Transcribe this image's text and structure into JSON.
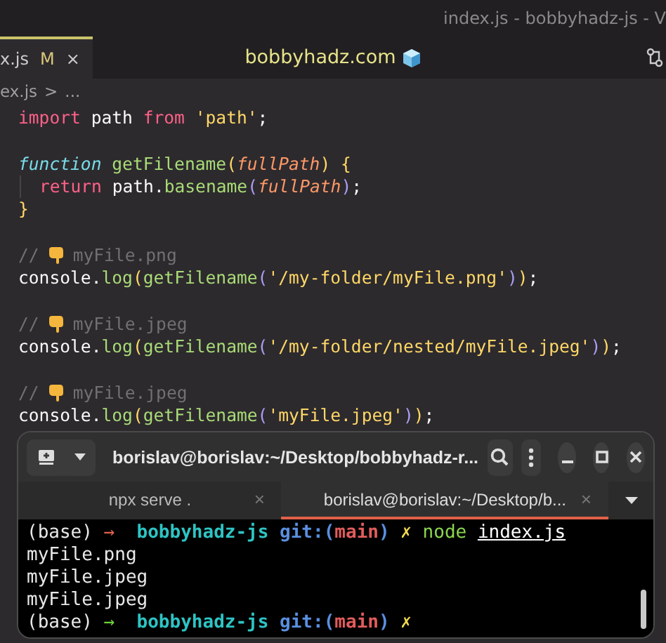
{
  "window": {
    "title": "index.js - bobbyhadz-js - V"
  },
  "editor_tabs": [
    {
      "label": "x.js",
      "badge": "M",
      "close": "×",
      "selected": true
    }
  ],
  "site_label": "bobbyhadz.com",
  "breadcrumb": {
    "file": "ex.js",
    "separator": ">",
    "rest": "..."
  },
  "code_lines": [
    {
      "kind": "code",
      "indented": false,
      "tokens": [
        {
          "kind": "kw",
          "text": "import"
        },
        {
          "kind": "plain",
          "text": " path "
        },
        {
          "kind": "kw",
          "text": "from "
        },
        {
          "kind": "str",
          "text": "'path'"
        },
        {
          "kind": "plain",
          "text": ";"
        }
      ]
    },
    {
      "kind": "blank"
    },
    {
      "kind": "code",
      "indented": false,
      "tokens": [
        {
          "kind": "storage",
          "text": "function "
        },
        {
          "kind": "fn",
          "text": "getFilename"
        },
        {
          "kind": "brace",
          "text": "("
        },
        {
          "kind": "param",
          "text": "fullPath"
        },
        {
          "kind": "brace",
          "text": ") {"
        }
      ]
    },
    {
      "kind": "code",
      "indented": true,
      "tokens": [
        {
          "kind": "kw",
          "text": "return"
        },
        {
          "kind": "plain",
          "text": " path."
        },
        {
          "kind": "fn",
          "text": "basename"
        },
        {
          "kind": "paren",
          "text": "("
        },
        {
          "kind": "param",
          "text": "fullPath"
        },
        {
          "kind": "paren",
          "text": ")"
        },
        {
          "kind": "plain",
          "text": ";"
        }
      ]
    },
    {
      "kind": "code",
      "indented": false,
      "tokens": [
        {
          "kind": "brace",
          "text": "}"
        }
      ]
    },
    {
      "kind": "blank"
    },
    {
      "kind": "code",
      "indented": false,
      "tokens": [
        {
          "kind": "comment",
          "text": "//"
        },
        {
          "kind": "hand"
        },
        {
          "kind": "comment",
          "text": "myFile.png"
        }
      ]
    },
    {
      "kind": "code",
      "indented": false,
      "tokens": [
        {
          "kind": "plain",
          "text": "console."
        },
        {
          "kind": "fn",
          "text": "log"
        },
        {
          "kind": "brace",
          "text": "("
        },
        {
          "kind": "fn",
          "text": "getFilename"
        },
        {
          "kind": "paren",
          "text": "("
        },
        {
          "kind": "str",
          "text": "'/my-folder/myFile.png'"
        },
        {
          "kind": "paren",
          "text": ")"
        },
        {
          "kind": "brace",
          "text": ")"
        },
        {
          "kind": "plain",
          "text": ";"
        }
      ]
    },
    {
      "kind": "blank"
    },
    {
      "kind": "code",
      "indented": false,
      "tokens": [
        {
          "kind": "comment",
          "text": "//"
        },
        {
          "kind": "hand"
        },
        {
          "kind": "comment",
          "text": "myFile.jpeg"
        }
      ]
    },
    {
      "kind": "code",
      "indented": false,
      "tokens": [
        {
          "kind": "plain",
          "text": "console."
        },
        {
          "kind": "fn",
          "text": "log"
        },
        {
          "kind": "brace",
          "text": "("
        },
        {
          "kind": "fn",
          "text": "getFilename"
        },
        {
          "kind": "paren",
          "text": "("
        },
        {
          "kind": "str",
          "text": "'/my-folder/nested/myFile.jpeg'"
        },
        {
          "kind": "paren",
          "text": ")"
        },
        {
          "kind": "brace",
          "text": ")"
        },
        {
          "kind": "plain",
          "text": ";"
        }
      ]
    },
    {
      "kind": "blank"
    },
    {
      "kind": "code",
      "indented": false,
      "tokens": [
        {
          "kind": "comment",
          "text": "//"
        },
        {
          "kind": "hand"
        },
        {
          "kind": "comment",
          "text": "myFile.jpeg"
        }
      ]
    },
    {
      "kind": "code",
      "indented": false,
      "tokens": [
        {
          "kind": "plain",
          "text": "console."
        },
        {
          "kind": "fn",
          "text": "log"
        },
        {
          "kind": "brace",
          "text": "("
        },
        {
          "kind": "fn",
          "text": "getFilename"
        },
        {
          "kind": "paren",
          "text": "("
        },
        {
          "kind": "str",
          "text": "'myFile.jpeg'"
        },
        {
          "kind": "paren",
          "text": ")"
        },
        {
          "kind": "brace",
          "text": ")"
        },
        {
          "kind": "plain",
          "text": ";"
        }
      ]
    }
  ],
  "terminal": {
    "title": "borislav@borislav:~/Desktop/bobbyhadz-r...",
    "tabs": [
      {
        "label": "npx serve .",
        "close": "×",
        "selected": false
      },
      {
        "label": "borislav@borislav:~/Desktop/b...",
        "close": "×",
        "selected": true
      }
    ],
    "lines": [
      [
        {
          "kind": "plain",
          "text": "(base) "
        },
        {
          "kind": "arrow",
          "ok": false,
          "text": "→"
        },
        {
          "kind": "dir",
          "text": "  bobbyhadz-js "
        },
        {
          "kind": "git",
          "text": "git:("
        },
        {
          "kind": "branch",
          "text": "main"
        },
        {
          "kind": "git",
          "text": ")"
        },
        {
          "kind": "dirty",
          "text": " ✗ "
        },
        {
          "kind": "cmd",
          "text": "node "
        },
        {
          "kind": "arg",
          "text": "index.js"
        }
      ],
      [
        {
          "kind": "plain",
          "text": "myFile.png"
        }
      ],
      [
        {
          "kind": "plain",
          "text": "myFile.jpeg"
        }
      ],
      [
        {
          "kind": "plain",
          "text": "myFile.jpeg"
        }
      ],
      [
        {
          "kind": "plain",
          "text": "(base) "
        },
        {
          "kind": "arrow",
          "ok": true,
          "text": "→"
        },
        {
          "kind": "dir",
          "text": "  bobbyhadz-js "
        },
        {
          "kind": "git",
          "text": "git:("
        },
        {
          "kind": "branch",
          "text": "main"
        },
        {
          "kind": "git",
          "text": ")"
        },
        {
          "kind": "dirty",
          "text": " ✗"
        }
      ]
    ]
  }
}
